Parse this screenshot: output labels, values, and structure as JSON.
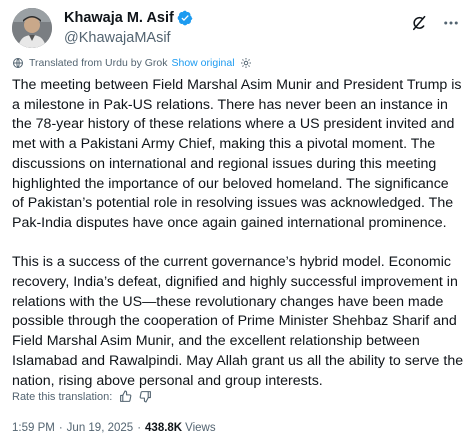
{
  "author": {
    "display_name": "Khawaja M. Asif",
    "handle": "@KhawajaMAsif",
    "verified": true
  },
  "translation": {
    "label": "Translated from Urdu by Grok",
    "show_original": "Show original"
  },
  "tweet": {
    "paragraphs": [
      "The meeting between Field Marshal Asim Munir and President Trump is a milestone in Pak-US relations. There has never been an instance in the 78-year history of these relations where a US president invited and met with a Pakistani Army Chief, making this a pivotal moment. The discussions on international and regional issues during this meeting highlighted the importance of our beloved homeland. The significance of Pakistan’s potential role in resolving issues was acknowledged. The Pak-India disputes have once again gained international prominence.",
      "This is a success of the current governance’s hybrid model. Economic recovery, India’s defeat, dignified and highly successful improvement in relations with the US—these revolutionary changes have been made possible through the cooperation of Prime Minister Shehbaz Sharif and Field Marshal Asim Munir, and the excellent relationship between Islamabad and Rawalpindi. May Allah grant us all the ability to serve the nation, rising above personal and group interests."
    ]
  },
  "rate": {
    "label": "Rate this translation:"
  },
  "meta": {
    "time": "1:59 PM",
    "date": "Jun 19, 2025",
    "separator": "·",
    "views_count": "438.8K",
    "views_label": "Views"
  },
  "icons": {
    "verified": "verified-badge-icon",
    "grok": "grok-icon",
    "more": "more-dots-icon",
    "globe": "globe-icon",
    "settings": "settings-gear-icon",
    "thumbs_up": "thumbs-up-icon",
    "thumbs_down": "thumbs-down-icon"
  },
  "colors": {
    "accent": "#1d9bf0",
    "text": "#0f1419",
    "secondary": "#536471"
  }
}
